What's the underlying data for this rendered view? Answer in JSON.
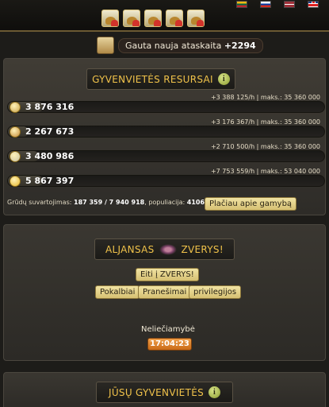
{
  "report": {
    "text": "Gauta nauja ataskaita",
    "amount": "+2294"
  },
  "resources": {
    "title": "GYVENVIETĖS RESURSAI",
    "info_glyph": "i",
    "items": [
      {
        "icon": "wood-icon",
        "value": "3 876 316",
        "rate": "+3 388 125/h | maks.: 35 360 000",
        "fill": 0.11,
        "color": "#c9a34a"
      },
      {
        "icon": "clay-icon",
        "value": "2 267 673",
        "rate": "+3 176 367/h | maks.: 35 360 000",
        "fill": 0.064,
        "color": "#c48a3a"
      },
      {
        "icon": "iron-icon",
        "value": "3 480 986",
        "rate": "+2 710 500/h | maks.: 35 360 000",
        "fill": 0.098,
        "color": "#c9c4a6"
      },
      {
        "icon": "grain-icon",
        "value": "5 867 397",
        "rate": "+7 753 559/h | maks.: 53 040 000",
        "fill": 0.11,
        "color": "#e6b82c"
      }
    ],
    "grain_label": "Grūdų suvartojimas:",
    "grain_consumption": "187 359 / 7 940 918",
    "population_label": "populiacija:",
    "population": "4106.",
    "production_button": "Plačiau apie gamybą"
  },
  "alliance": {
    "label": "ALJANSAS",
    "name": "ZVERYS!",
    "goto_button": "Eiti į ZVERYS!",
    "buttons": [
      "Pokalbiai",
      "Pranešimai",
      "privilegijos"
    ],
    "immunity_label": "Neliečiamybė",
    "immunity_timer": "17:04:23"
  },
  "villages": {
    "title": "JŪSŲ GYVENVIETĖS"
  },
  "colors": {
    "accent": "#f0c24a",
    "button": "#e6d38a",
    "timer": "#e08a2e"
  }
}
